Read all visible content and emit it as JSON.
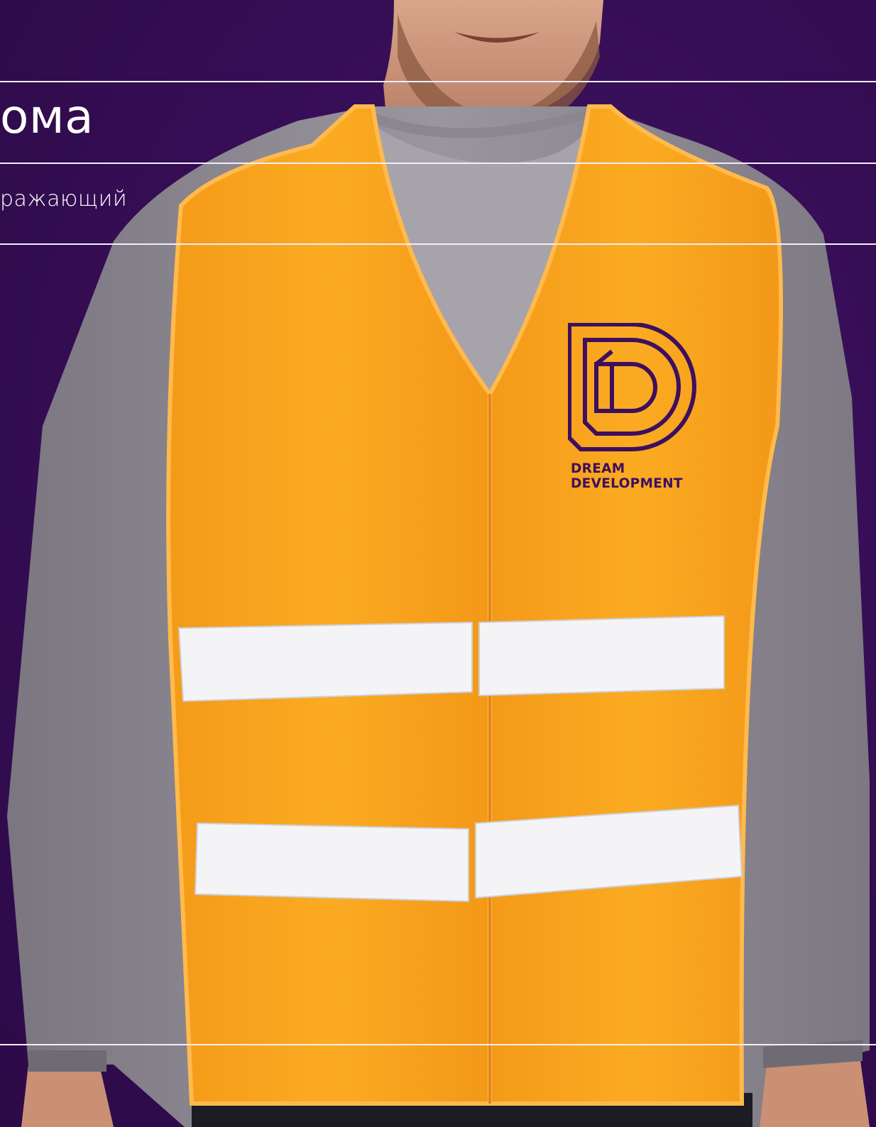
{
  "header": {
    "title": "ома",
    "subtitle": "ражающий"
  },
  "logo": {
    "line1": "DREAM",
    "line2": "DEVELOPMENT"
  },
  "colors": {
    "background": "#3a0f58",
    "vest": "#f7a21b",
    "reflective_stripe": "#f4f4f6",
    "shirt": "#8e8b92",
    "logo": "#3d0f5e"
  }
}
